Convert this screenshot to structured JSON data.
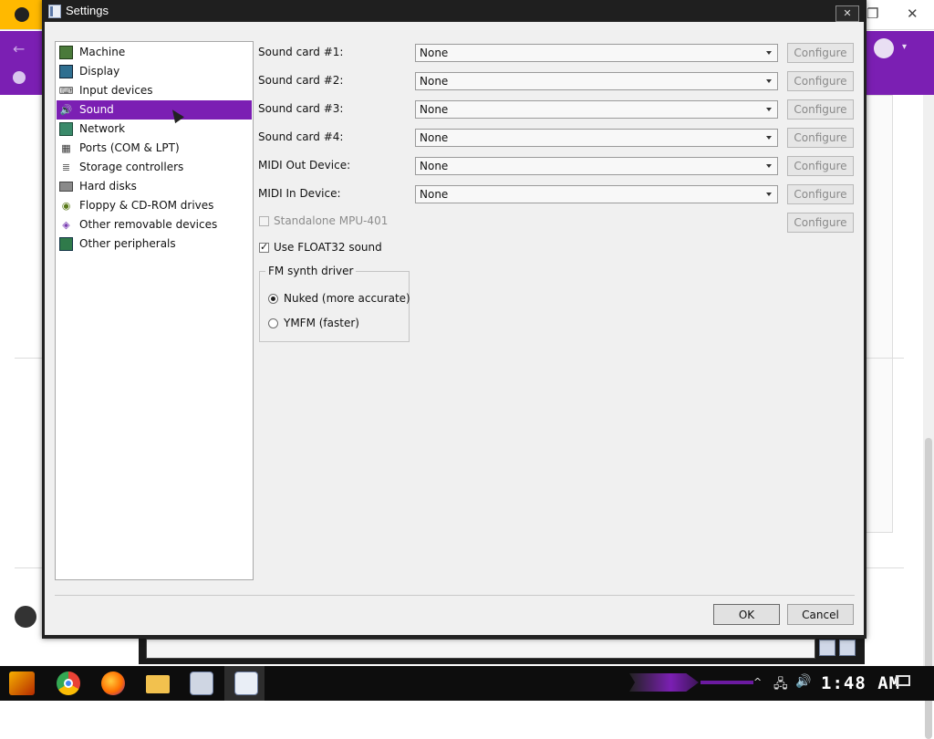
{
  "window": {
    "title": "Settings",
    "close_glyph": "✕"
  },
  "background_window": {
    "controls": {
      "minimize": "—",
      "restore": "❐",
      "close": "✕"
    }
  },
  "tree": {
    "items": [
      {
        "label": "Machine",
        "icon": "machine-icon",
        "selected": false
      },
      {
        "label": "Display",
        "icon": "display-icon",
        "selected": false
      },
      {
        "label": "Input devices",
        "icon": "input-devices-icon",
        "selected": false
      },
      {
        "label": "Sound",
        "icon": "sound-icon",
        "selected": true
      },
      {
        "label": "Network",
        "icon": "network-icon",
        "selected": false
      },
      {
        "label": "Ports (COM & LPT)",
        "icon": "ports-icon",
        "selected": false
      },
      {
        "label": "Storage controllers",
        "icon": "storage-controllers-icon",
        "selected": false
      },
      {
        "label": "Hard disks",
        "icon": "hard-disk-icon",
        "selected": false
      },
      {
        "label": "Floppy & CD-ROM drives",
        "icon": "floppy-cdrom-icon",
        "selected": false
      },
      {
        "label": "Other removable devices",
        "icon": "removable-devices-icon",
        "selected": false
      },
      {
        "label": "Other peripherals",
        "icon": "peripherals-icon",
        "selected": false
      }
    ]
  },
  "sound": {
    "rows": [
      {
        "label": "Sound card #1:",
        "value": "None",
        "configure": "Configure"
      },
      {
        "label": "Sound card #2:",
        "value": "None",
        "configure": "Configure"
      },
      {
        "label": "Sound card #3:",
        "value": "None",
        "configure": "Configure"
      },
      {
        "label": "Sound card #4:",
        "value": "None",
        "configure": "Configure"
      },
      {
        "label": "MIDI Out Device:",
        "value": "None",
        "configure": "Configure"
      },
      {
        "label": "MIDI In Device:",
        "value": "None",
        "configure": "Configure"
      }
    ],
    "mpu401": {
      "label": "Standalone MPU-401",
      "checked": false,
      "enabled": false,
      "configure": "Configure"
    },
    "float32": {
      "label": "Use FLOAT32 sound",
      "checked": true
    },
    "fm_synth": {
      "title": "FM synth driver",
      "options": [
        {
          "label": "Nuked (more accurate)",
          "selected": true
        },
        {
          "label": "YMFM (faster)",
          "selected": false
        }
      ]
    }
  },
  "buttons": {
    "ok": "OK",
    "cancel": "Cancel"
  },
  "taskbar": {
    "clock": "1:48 AM",
    "apps": [
      "start-menu-icon",
      "chrome-icon",
      "firefox-icon",
      "file-explorer-icon",
      "emulator-manager-icon",
      "emulator-icon"
    ]
  }
}
